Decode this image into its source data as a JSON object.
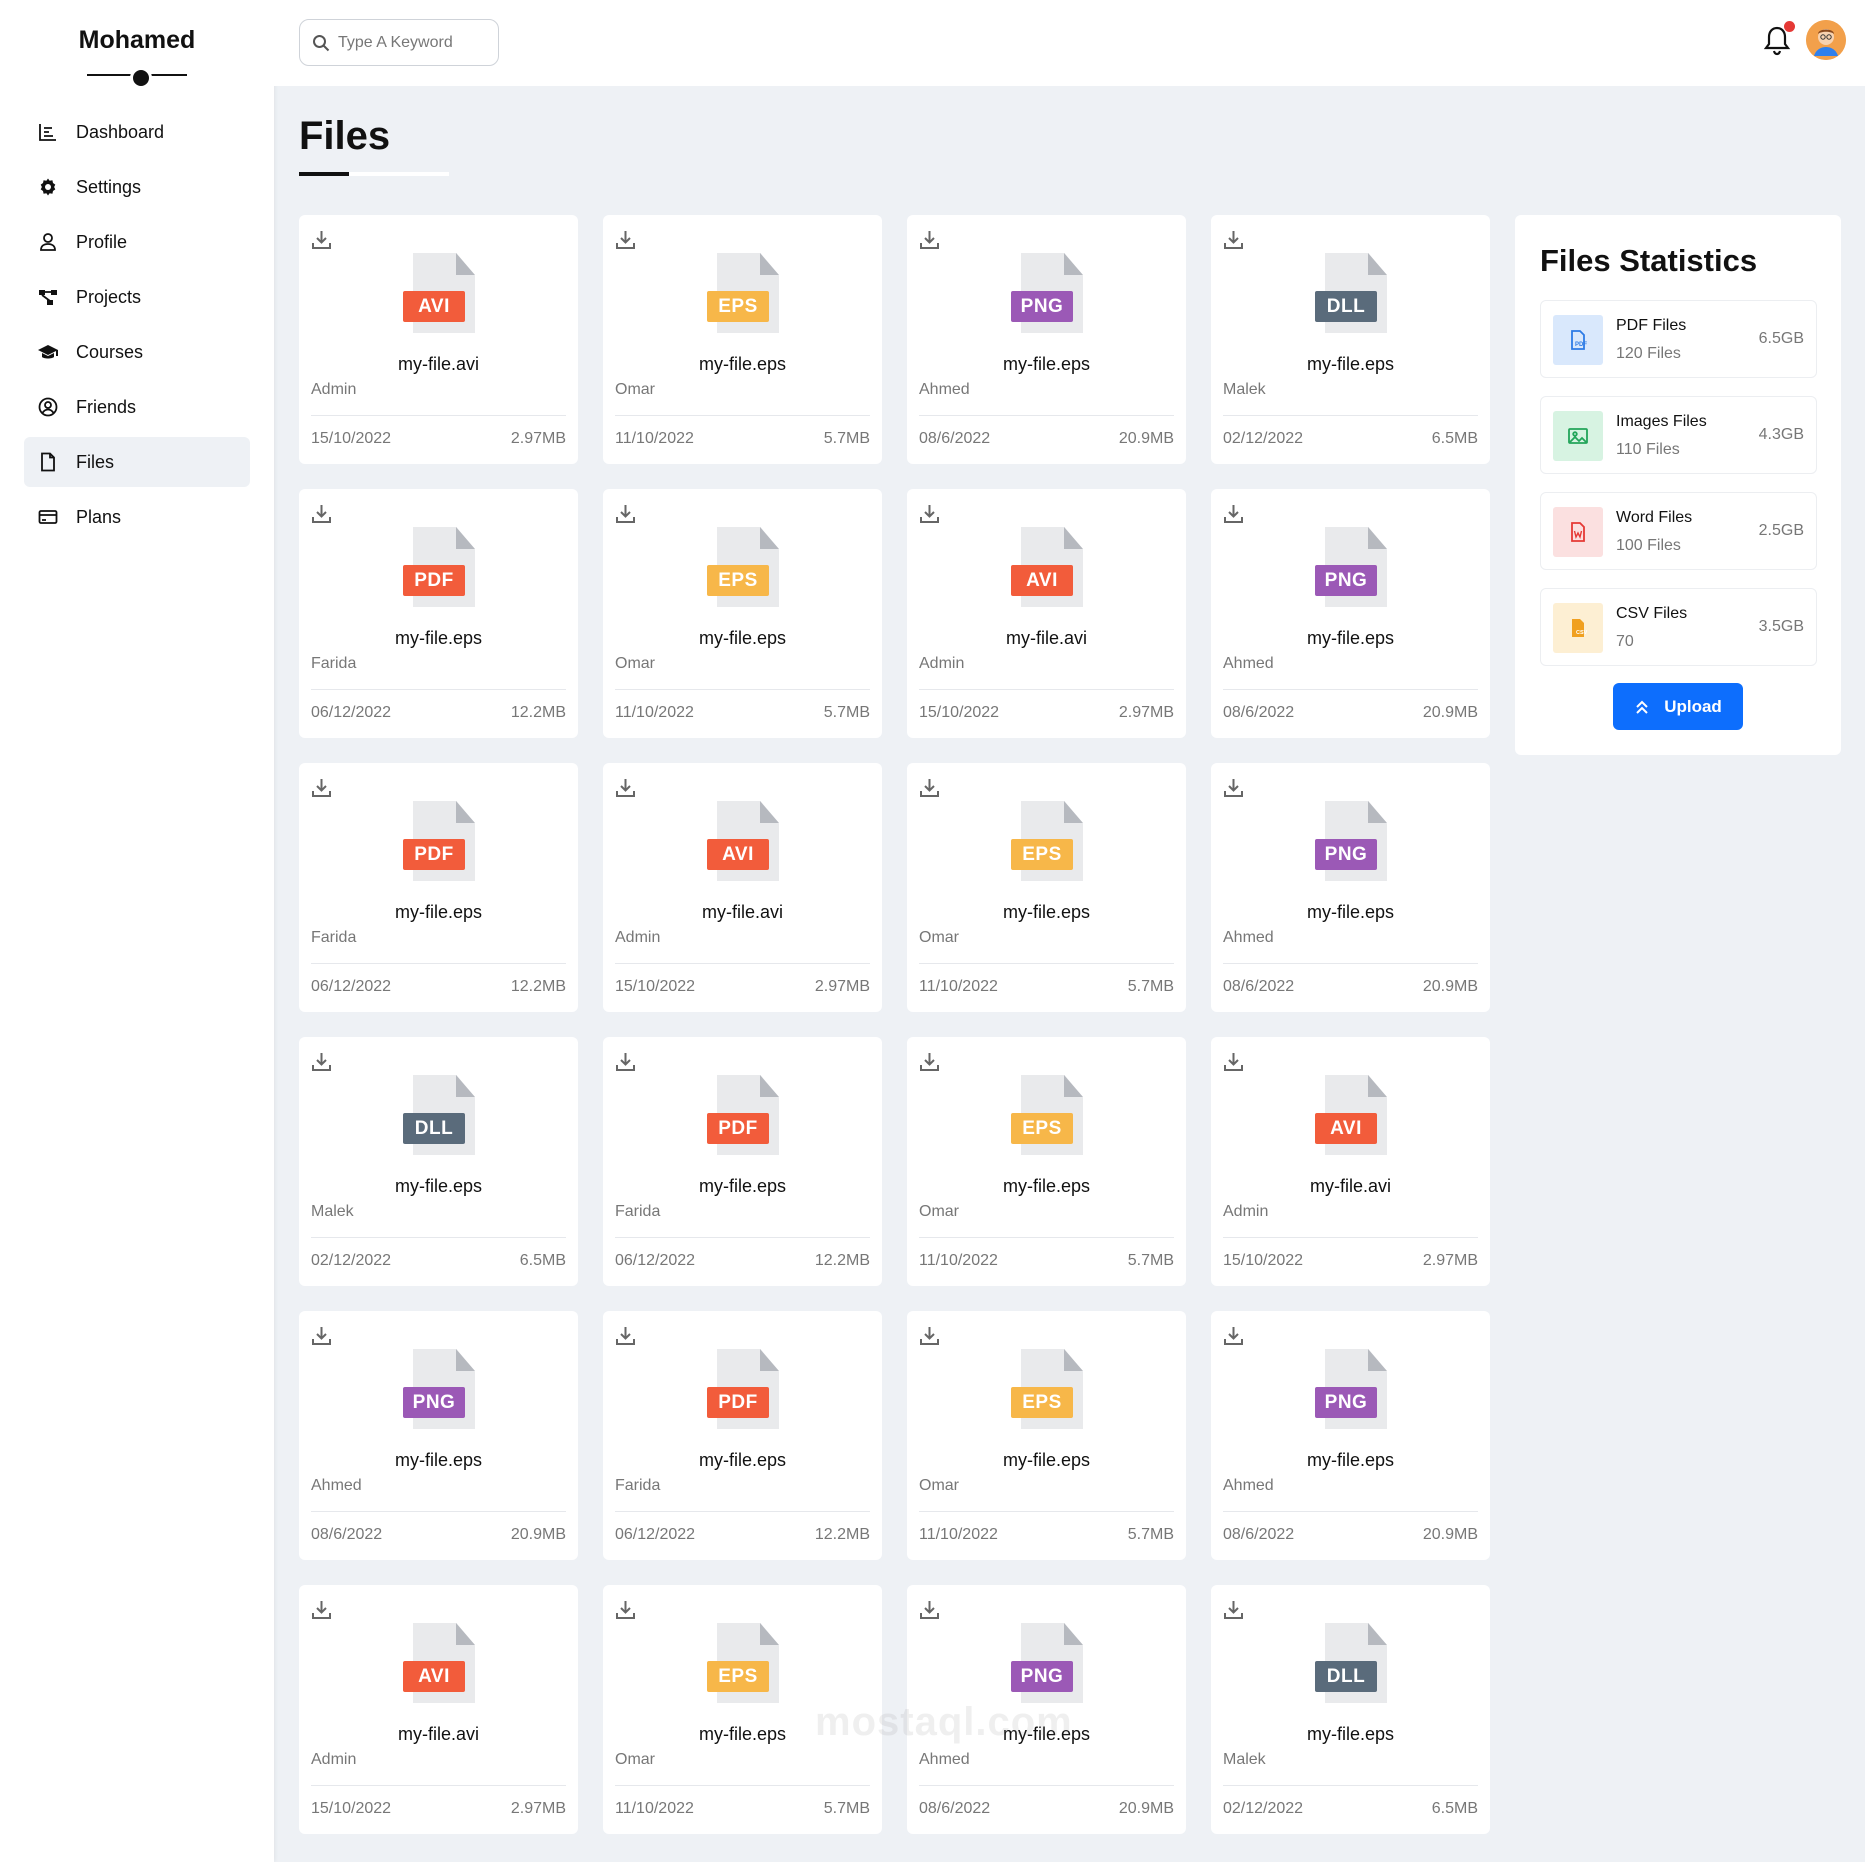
{
  "sidebar": {
    "brand": "Mohamed",
    "items": [
      {
        "label": "Dashboard",
        "icon": "chart-bar-icon",
        "active": false
      },
      {
        "label": "Settings",
        "icon": "gear-icon",
        "active": false
      },
      {
        "label": "Profile",
        "icon": "user-icon",
        "active": false
      },
      {
        "label": "Projects",
        "icon": "diagram-icon",
        "active": false
      },
      {
        "label": "Courses",
        "icon": "graduation-cap-icon",
        "active": false
      },
      {
        "label": "Friends",
        "icon": "user-circle-icon",
        "active": false
      },
      {
        "label": "Files",
        "icon": "file-icon",
        "active": true
      },
      {
        "label": "Plans",
        "icon": "credit-card-icon",
        "active": false
      }
    ]
  },
  "header": {
    "search_placeholder": "Type A Keyword",
    "notification_icon": "bell-icon",
    "avatar_icon": "avatar"
  },
  "page": {
    "title": "Files"
  },
  "type_colors": {
    "AVI": "#f25c3b",
    "EPS": "#f7b749",
    "PNG": "#9b59b6",
    "DLL": "#5a6b7b",
    "PDF": "#f25c3b"
  },
  "files": [
    {
      "type": "AVI",
      "name": "my-file.avi",
      "owner": "Admin",
      "date": "15/10/2022",
      "size": "2.97MB"
    },
    {
      "type": "EPS",
      "name": "my-file.eps",
      "owner": "Omar",
      "date": "11/10/2022",
      "size": "5.7MB"
    },
    {
      "type": "PNG",
      "name": "my-file.eps",
      "owner": "Ahmed",
      "date": "08/6/2022",
      "size": "20.9MB"
    },
    {
      "type": "DLL",
      "name": "my-file.eps",
      "owner": "Malek",
      "date": "02/12/2022",
      "size": "6.5MB"
    },
    {
      "type": "PDF",
      "name": "my-file.eps",
      "owner": "Farida",
      "date": "06/12/2022",
      "size": "12.2MB"
    },
    {
      "type": "EPS",
      "name": "my-file.eps",
      "owner": "Omar",
      "date": "11/10/2022",
      "size": "5.7MB"
    },
    {
      "type": "AVI",
      "name": "my-file.avi",
      "owner": "Admin",
      "date": "15/10/2022",
      "size": "2.97MB"
    },
    {
      "type": "PNG",
      "name": "my-file.eps",
      "owner": "Ahmed",
      "date": "08/6/2022",
      "size": "20.9MB"
    },
    {
      "type": "PDF",
      "name": "my-file.eps",
      "owner": "Farida",
      "date": "06/12/2022",
      "size": "12.2MB"
    },
    {
      "type": "AVI",
      "name": "my-file.avi",
      "owner": "Admin",
      "date": "15/10/2022",
      "size": "2.97MB"
    },
    {
      "type": "EPS",
      "name": "my-file.eps",
      "owner": "Omar",
      "date": "11/10/2022",
      "size": "5.7MB"
    },
    {
      "type": "PNG",
      "name": "my-file.eps",
      "owner": "Ahmed",
      "date": "08/6/2022",
      "size": "20.9MB"
    },
    {
      "type": "DLL",
      "name": "my-file.eps",
      "owner": "Malek",
      "date": "02/12/2022",
      "size": "6.5MB"
    },
    {
      "type": "PDF",
      "name": "my-file.eps",
      "owner": "Farida",
      "date": "06/12/2022",
      "size": "12.2MB"
    },
    {
      "type": "EPS",
      "name": "my-file.eps",
      "owner": "Omar",
      "date": "11/10/2022",
      "size": "5.7MB"
    },
    {
      "type": "AVI",
      "name": "my-file.avi",
      "owner": "Admin",
      "date": "15/10/2022",
      "size": "2.97MB"
    },
    {
      "type": "PNG",
      "name": "my-file.eps",
      "owner": "Ahmed",
      "date": "08/6/2022",
      "size": "20.9MB"
    },
    {
      "type": "PDF",
      "name": "my-file.eps",
      "owner": "Farida",
      "date": "06/12/2022",
      "size": "12.2MB"
    },
    {
      "type": "EPS",
      "name": "my-file.eps",
      "owner": "Omar",
      "date": "11/10/2022",
      "size": "5.7MB"
    },
    {
      "type": "PNG",
      "name": "my-file.eps",
      "owner": "Ahmed",
      "date": "08/6/2022",
      "size": "20.9MB"
    },
    {
      "type": "AVI",
      "name": "my-file.avi",
      "owner": "Admin",
      "date": "15/10/2022",
      "size": "2.97MB"
    },
    {
      "type": "EPS",
      "name": "my-file.eps",
      "owner": "Omar",
      "date": "11/10/2022",
      "size": "5.7MB"
    },
    {
      "type": "PNG",
      "name": "my-file.eps",
      "owner": "Ahmed",
      "date": "08/6/2022",
      "size": "20.9MB"
    },
    {
      "type": "DLL",
      "name": "my-file.eps",
      "owner": "Malek",
      "date": "02/12/2022",
      "size": "6.5MB"
    }
  ],
  "stats": {
    "title": "Files Statistics",
    "items": [
      {
        "name": "PDF Files",
        "count": "120 Files",
        "size": "6.5GB",
        "icon": "pdf-file-icon",
        "color": "#2d7be5",
        "bg": "#d9e8fc"
      },
      {
        "name": "Images Files",
        "count": "110 Files",
        "size": "4.3GB",
        "icon": "image-file-icon",
        "color": "#23a55a",
        "bg": "#d7f3e2"
      },
      {
        "name": "Word Files",
        "count": "100 Files",
        "size": "2.5GB",
        "icon": "word-file-icon",
        "color": "#e53935",
        "bg": "#fbe0e0"
      },
      {
        "name": "CSV Files",
        "count": "70",
        "size": "3.5GB",
        "icon": "csv-file-icon",
        "color": "#f0a020",
        "bg": "#fdefd3"
      }
    ],
    "upload_label": "Upload"
  },
  "watermark": "mostaql.com"
}
